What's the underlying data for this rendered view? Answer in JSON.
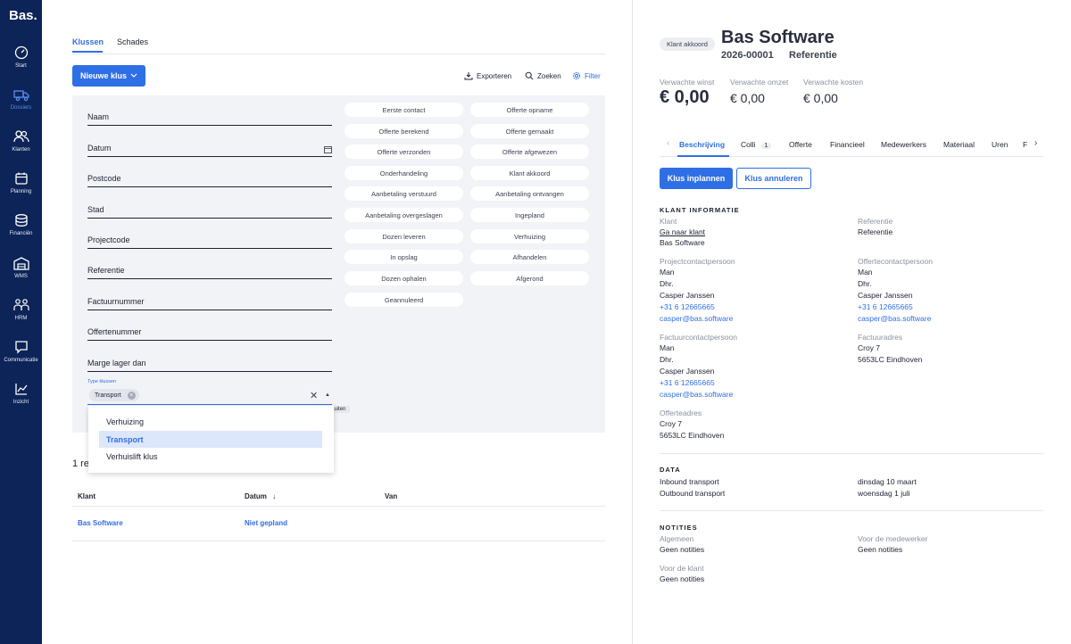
{
  "app": {
    "logo": "Bas."
  },
  "sidebar": {
    "items": [
      {
        "label": "Start",
        "icon": "dashboard-icon"
      },
      {
        "label": "Dossiers",
        "icon": "truck-icon",
        "active": true
      },
      {
        "label": "Klanten",
        "icon": "users-icon"
      },
      {
        "label": "Planning",
        "icon": "calendar-icon"
      },
      {
        "label": "Financiën",
        "icon": "coins-icon"
      },
      {
        "label": "WMS",
        "icon": "warehouse-icon"
      },
      {
        "label": "HRM",
        "icon": "people-icon"
      },
      {
        "label": "Communicatie",
        "icon": "chat-icon"
      },
      {
        "label": "Inzicht",
        "icon": "chart-icon"
      }
    ]
  },
  "main": {
    "tabs": [
      "Klussen",
      "Schades"
    ],
    "new_job_label": "Nieuwe klus",
    "actions": {
      "export": "Exporteren",
      "search": "Zoeken",
      "filter": "Filter"
    },
    "fields": [
      "Naam",
      "Datum",
      "Postcode",
      "Stad",
      "Projectcode",
      "Referentie",
      "Factuurnummer",
      "Offertenummer",
      "Marge lager dan"
    ],
    "statuses_left": [
      "Eerste contact",
      "Offerte berekend",
      "Offerte verzonden",
      "Onderhandeling",
      "Aanbetaling verstuurd",
      "Aanbetaling overgeslagen",
      "Dozen leveren",
      "In opslag",
      "Dozen ophalen",
      "Geannuleerd"
    ],
    "statuses_right": [
      "Offerte opname",
      "Offerte gemaakt",
      "Offerte afgewezen",
      "Klant akkoord",
      "Aanbetaling ontvangen",
      "Ingepland",
      "Verhuizing",
      "Afhandelen",
      "Afgerond"
    ],
    "type_label": "Type klussen",
    "type_chip": "Transport",
    "close_tooltip": "Sluiten",
    "dropdown_options": [
      "Verhuizing",
      "Transport",
      "Verhuislift klus"
    ],
    "dropdown_selected": "Transport",
    "results_text": "1 re",
    "table": {
      "headers": [
        "Klant",
        "Datum",
        "Van"
      ],
      "rows": [
        {
          "klant": "Bas Software",
          "datum": "Niet gepland",
          "van": ""
        }
      ]
    }
  },
  "detail": {
    "badge": "Klant akkoord",
    "title": "Bas Software",
    "number": "2026-00001",
    "reference": "Referentie",
    "stats": [
      {
        "label": "Verwachte winst",
        "value": "€ 0,00"
      },
      {
        "label": "Verwachte omzet",
        "value": "€ 0,00"
      },
      {
        "label": "Verwachte kosten",
        "value": "€ 0,00"
      }
    ],
    "tabs": [
      "Beschrijving",
      "Colli",
      "Offerte",
      "Financieel",
      "Medewerkers",
      "Materiaal",
      "Uren",
      "F"
    ],
    "colli_count": "1",
    "plan_button": "Klus inplannen",
    "cancel_button": "Klus annuleren",
    "client_info": {
      "title": "KLANT INFORMATIE",
      "klant_label": "Klant",
      "klant_link": "Ga naar klant",
      "klant_name": "Bas Software",
      "referentie_label": "Referentie",
      "referentie_value": "Referentie",
      "project_contact_label": "Projectcontactpersoon",
      "project_contact": [
        "Man",
        "Dhr.",
        "Casper Janssen",
        "+31 6 12665665",
        "casper@bas.software"
      ],
      "offerte_contact_label": "Offertecontactpersoon",
      "offerte_contact": [
        "Man",
        "Dhr.",
        "Casper Janssen",
        "+31 6 12665665",
        "casper@bas.software"
      ],
      "factuur_contact_label": "Factuurcontactpersoon",
      "factuur_contact": [
        "Man",
        "Dhr.",
        "Casper Janssen",
        "+31 6 12665665",
        "casper@bas.software"
      ],
      "factuur_address_label": "Factuuradres",
      "factuur_address": [
        "Croy 7",
        "5653LC Eindhoven"
      ],
      "offerte_address_label": "Offerteadres",
      "offerte_address": [
        "Croy 7",
        "5653LC Eindhoven"
      ]
    },
    "data": {
      "title": "DATA",
      "rows": [
        {
          "label": "Inbound transport",
          "value": "dinsdag 10 maart"
        },
        {
          "label": "Outbound transport",
          "value": "woensdag 1 juli"
        }
      ]
    },
    "notes": {
      "title": "NOTITIES",
      "general_label": "Algemeen",
      "general_value": "Geen notities",
      "employee_label": "Voor de medewerker",
      "employee_value": "Geen notities",
      "client_label": "Voor de klant",
      "client_value": "Geen notities"
    }
  },
  "colors": {
    "sidebar": "#0c2457",
    "accent": "#2f6fe6",
    "panel": "#f1f3f6"
  }
}
